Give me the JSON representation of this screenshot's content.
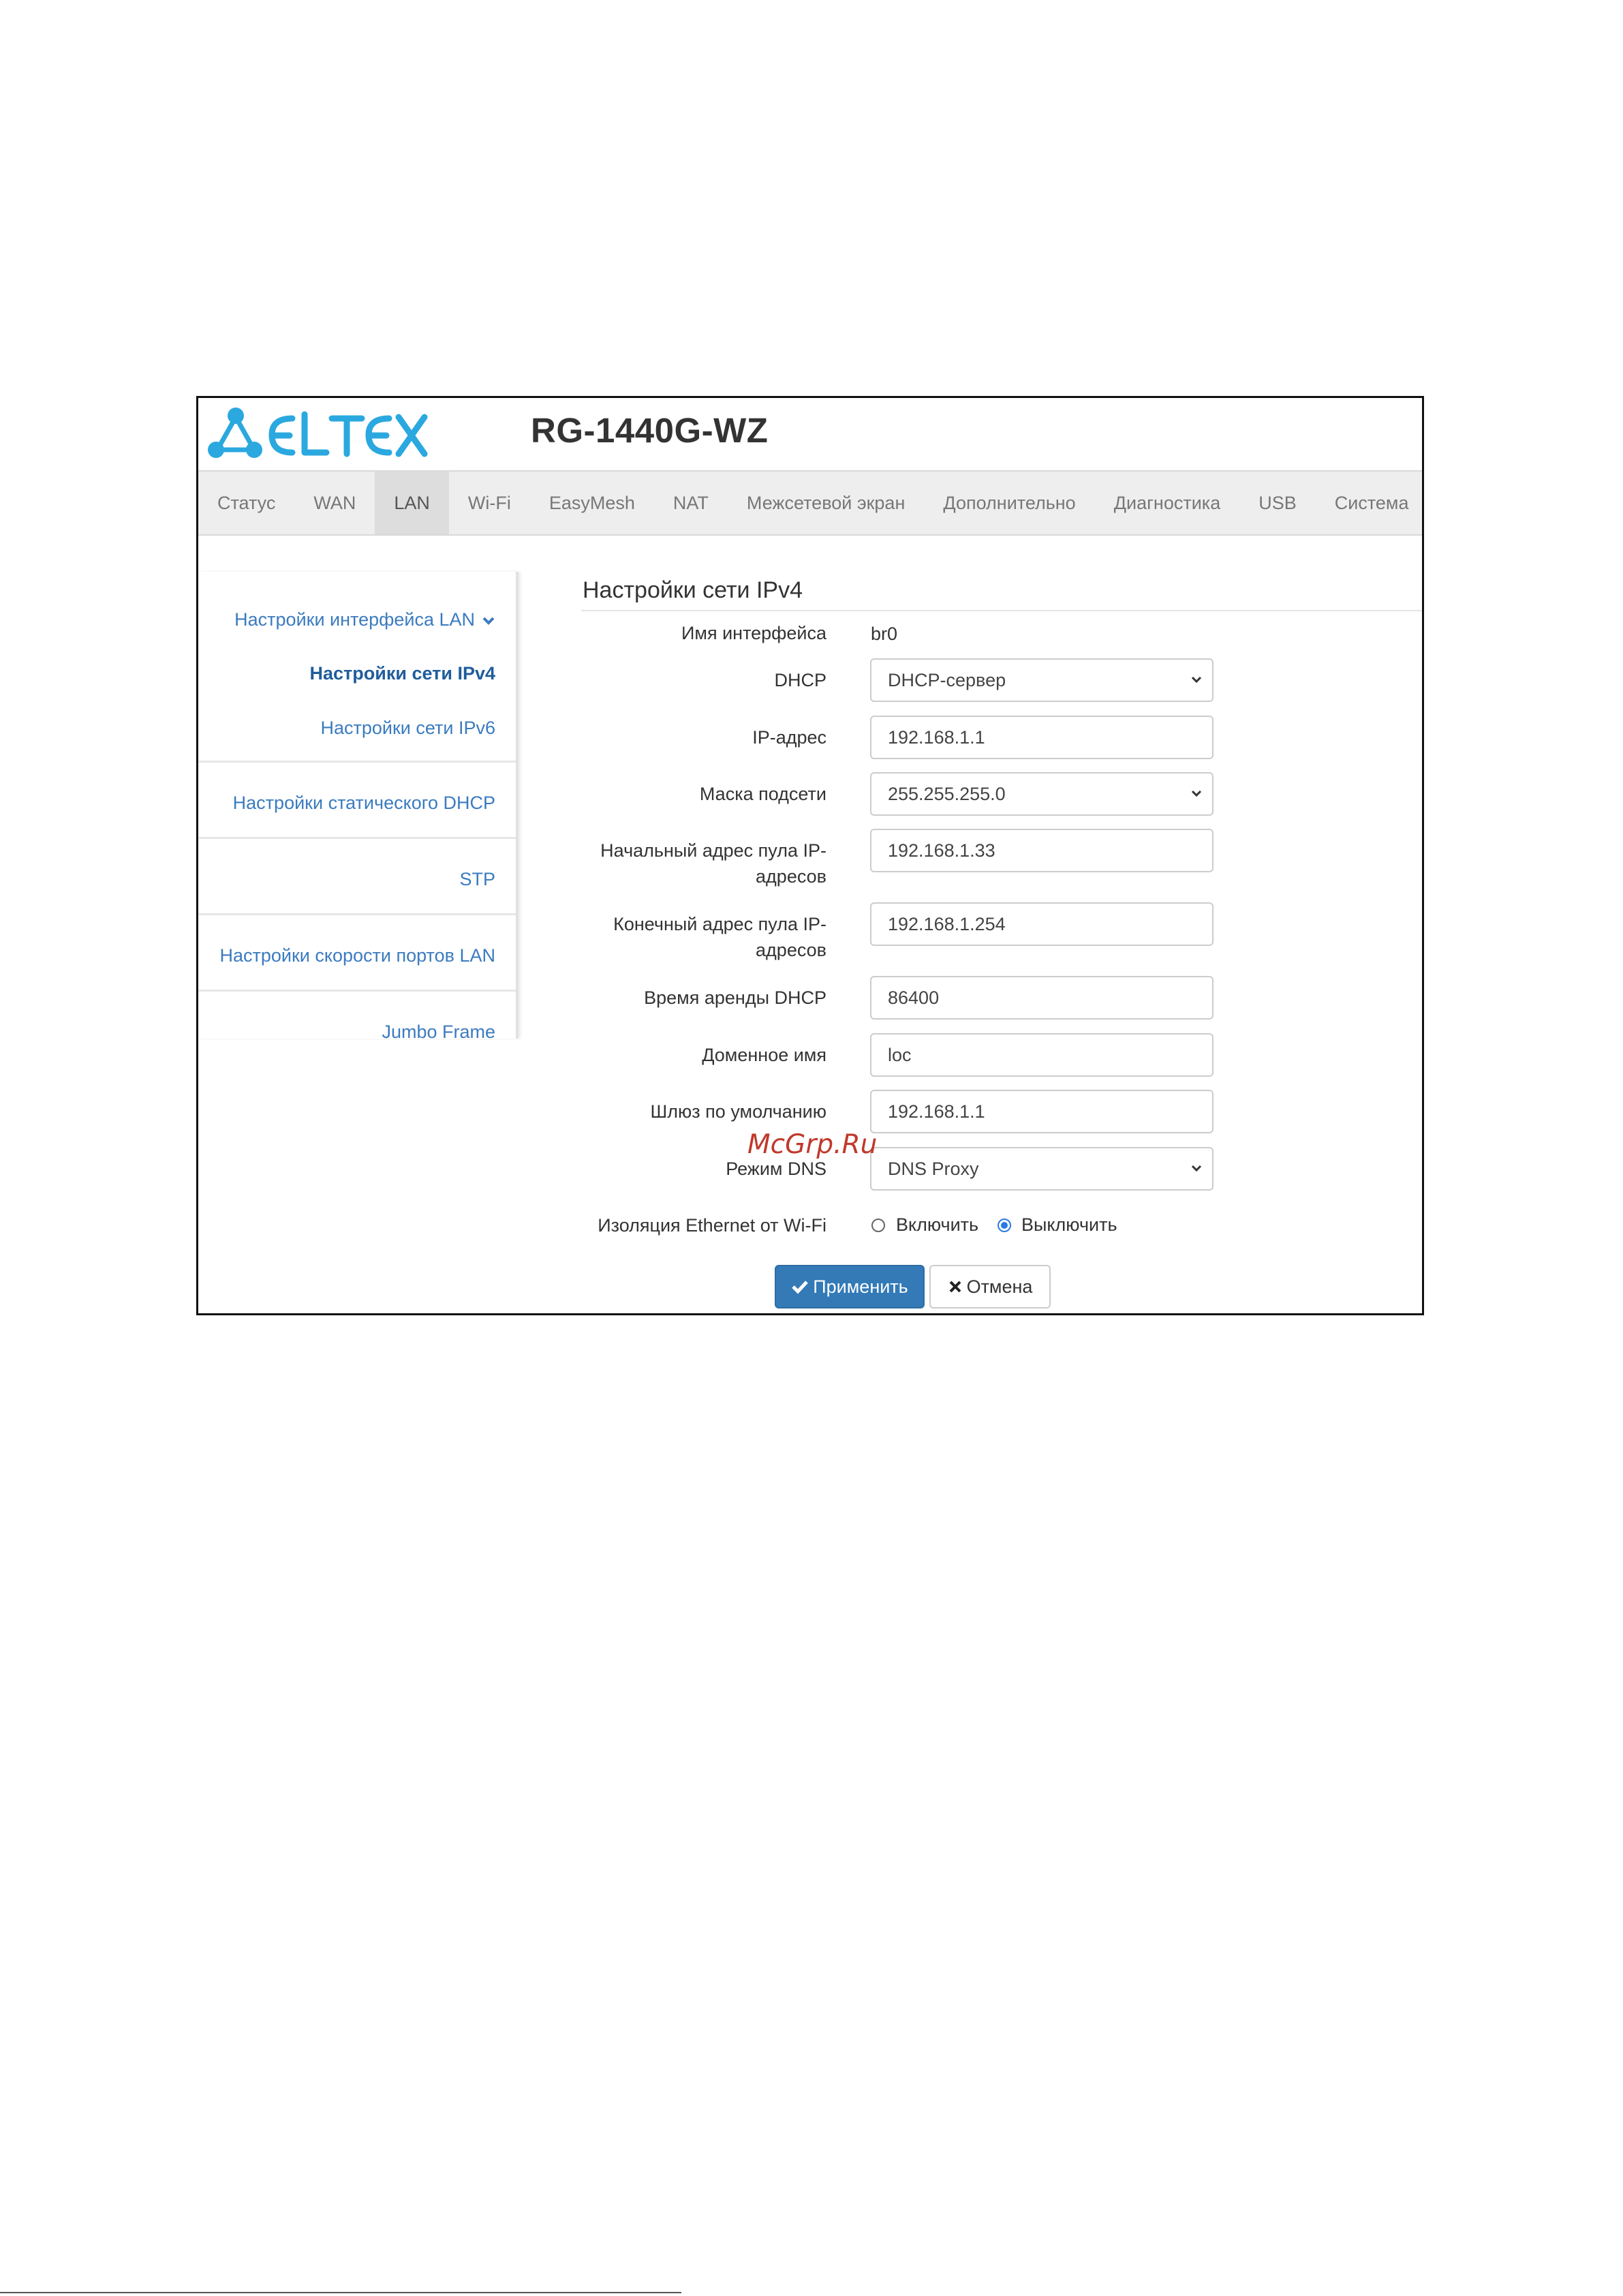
{
  "header": {
    "brand": "ELTEX",
    "model": "RG-1440G-WZ",
    "brand_color": "#2aa8df"
  },
  "nav": {
    "tabs": [
      {
        "label": "Статус"
      },
      {
        "label": "WAN"
      },
      {
        "label": "LAN",
        "active": true
      },
      {
        "label": "Wi-Fi"
      },
      {
        "label": "EasyMesh"
      },
      {
        "label": "NAT"
      },
      {
        "label": "Межсетевой экран"
      },
      {
        "label": "Дополнительно"
      },
      {
        "label": "Диагностика"
      },
      {
        "label": "USB"
      },
      {
        "label": "Система"
      }
    ]
  },
  "sidebar": {
    "group_label": "Настройки интерфейса LAN",
    "items": [
      {
        "label": "Настройки сети IPv4",
        "active": true
      },
      {
        "label": "Настройки сети IPv6"
      },
      {
        "label": "Настройки статического DHCP"
      },
      {
        "label": "STP"
      },
      {
        "label": "Настройки скорости портов LAN"
      },
      {
        "label": "Jumbo Frame"
      }
    ]
  },
  "form": {
    "title": "Настройки сети IPv4",
    "interface_name": {
      "label": "Имя интерфейса",
      "value": "br0"
    },
    "dhcp": {
      "label": "DHCP",
      "value": "DHCP-сервер"
    },
    "ip_address": {
      "label": "IP-адрес",
      "value": "192.168.1.1"
    },
    "subnet_mask": {
      "label": "Маска подсети",
      "value": "255.255.255.0"
    },
    "pool_start": {
      "label_line1": "Начальный адрес пула IP-",
      "label_line2": "адресов",
      "value": "192.168.1.33"
    },
    "pool_end": {
      "label_line1": "Конечный адрес пула IP-",
      "label_line2": "адресов",
      "value": "192.168.1.254"
    },
    "lease_time": {
      "label": "Время аренды DHCP",
      "value": "86400"
    },
    "domain_name": {
      "label": "Доменное имя",
      "value": "loc"
    },
    "default_gateway": {
      "label": "Шлюз по умолчанию",
      "value": "192.168.1.1"
    },
    "dns_mode": {
      "label": "Режим DNS",
      "value": "DNS Proxy"
    },
    "ethernet_isolation": {
      "label": "Изоляция Ethernet от Wi-Fi",
      "option_on": "Включить",
      "option_off": "Выключить",
      "selected": "Выключить"
    },
    "apply_label": "Применить",
    "cancel_label": "Отмена"
  },
  "watermark": "McGrp.Ru"
}
